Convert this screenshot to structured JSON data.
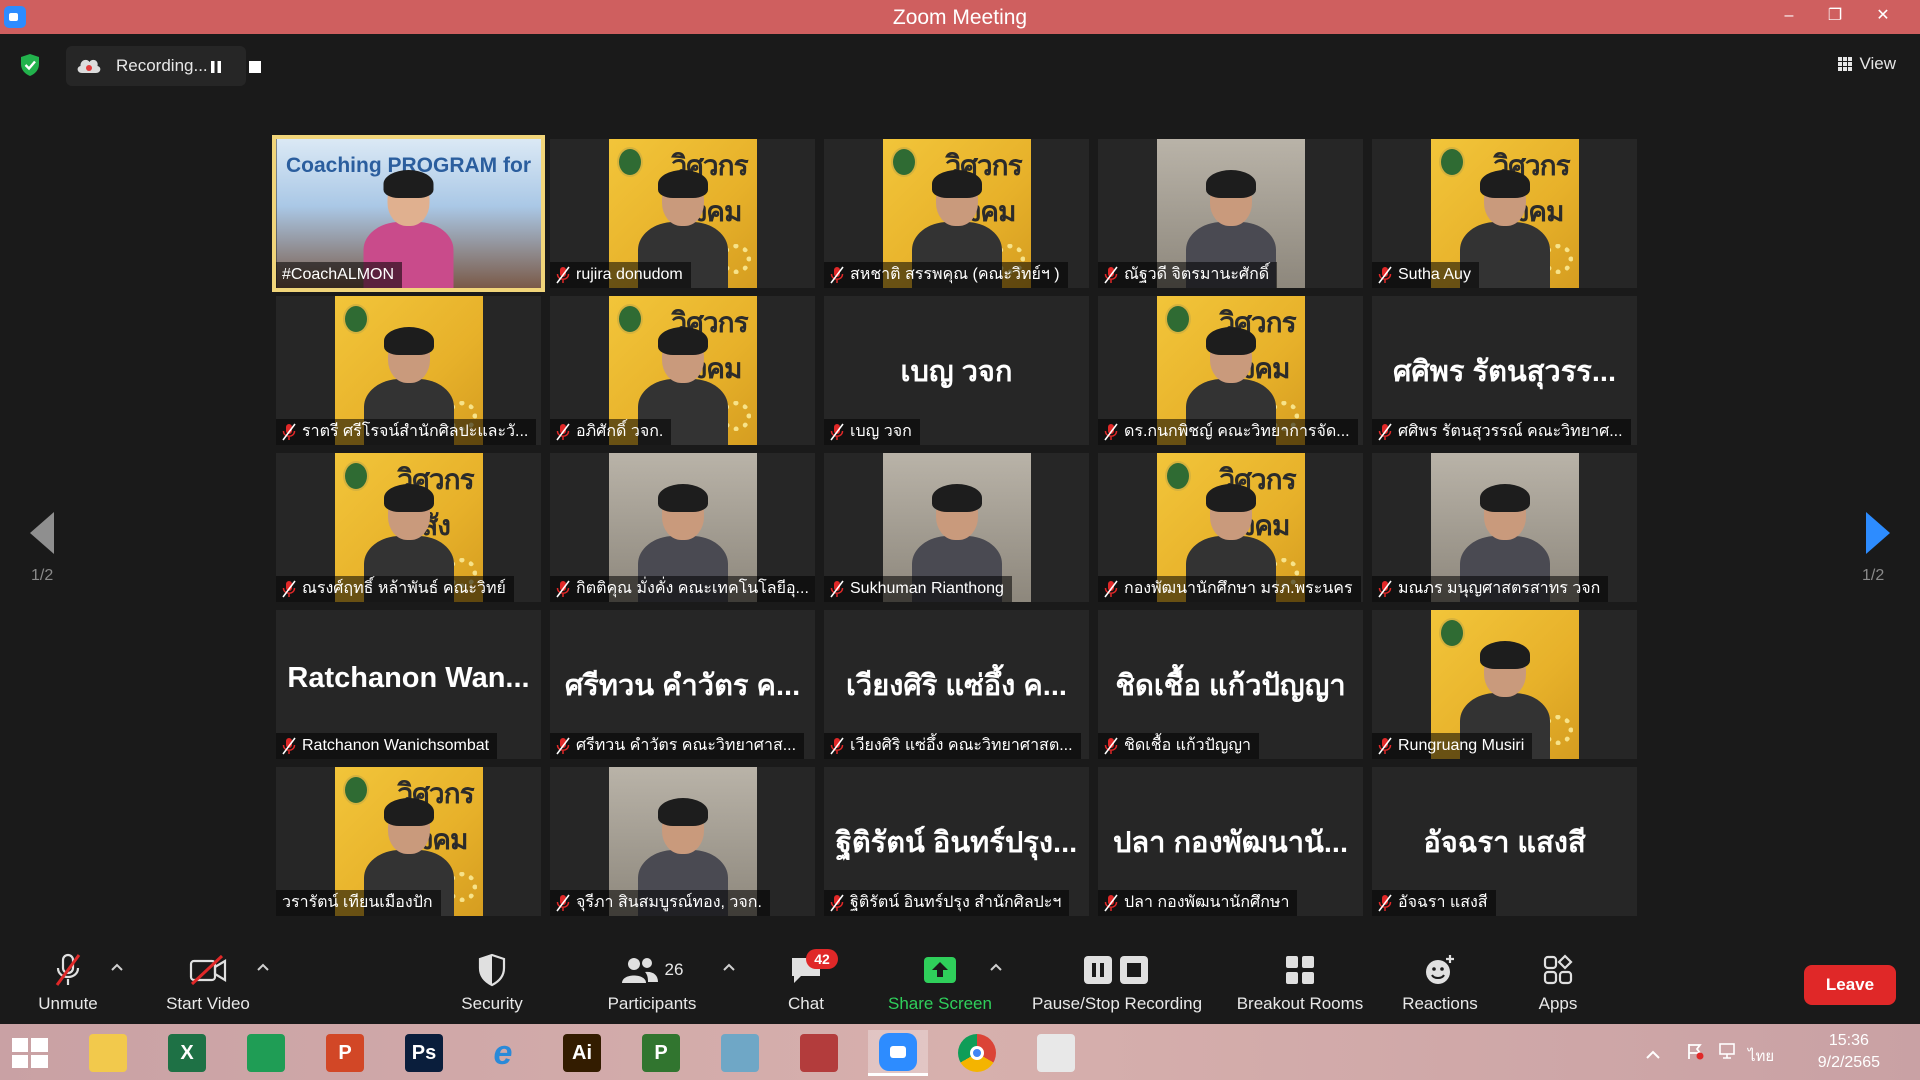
{
  "window": {
    "title": "Zoom Meeting",
    "minimize": "–",
    "restore": "❐",
    "close": "✕"
  },
  "top_bar": {
    "recording_label": "Recording...",
    "view_label": "View"
  },
  "pager": {
    "left": "1/2",
    "right": "1/2"
  },
  "participants": [
    {
      "name": "#CoachALMON",
      "video": "presenter",
      "active": true,
      "muted": false,
      "poster_text": "Coaching PROGRAM for"
    },
    {
      "name": "rujira donudom",
      "video": "poster",
      "muted": true,
      "poster_text": "วิศวกร สังคม"
    },
    {
      "name": "สหชาติ สรรพคุณ (คณะวิทย์ฯ )",
      "video": "poster",
      "muted": true,
      "poster_text": "วิศวกร สังคม"
    },
    {
      "name": "ณัฐวดี จิตรมานะศักดิ์",
      "video": "camera",
      "muted": true
    },
    {
      "name": "Sutha Auy",
      "video": "poster",
      "muted": true,
      "poster_text": "วิศวกร สังคม"
    },
    {
      "name": "ราตรี   ศรีโรจน์สำนักศิลปะและวั...",
      "video": "poster",
      "muted": true,
      "poster_text": ""
    },
    {
      "name": "อภิศักดิ์ วจก.",
      "video": "poster",
      "muted": true,
      "poster_text": "วิศวกร สังคม"
    },
    {
      "name": "เบญ วจก",
      "video": "none",
      "muted": true,
      "display_name": "เบญ วจก"
    },
    {
      "name": "ดร.กนกพิชญ์ คณะวิทยาการจัด...",
      "video": "poster",
      "muted": true,
      "poster_text": "วิศวกร สังคม"
    },
    {
      "name": "ศศิพร รัตนสุวรรณ์ คณะวิทยาศ...",
      "video": "none",
      "muted": true,
      "display_name": "ศศิพร รัตนสุวรร..."
    },
    {
      "name": "ณรงศ์ฤทธิ์ หล้าพันธ์ คณะวิทย์",
      "video": "poster",
      "muted": true,
      "poster_text": "วิศวกร สัง"
    },
    {
      "name": "กิตติคุณ มั่งคั่ง คณะเทคโนโลยีอุ...",
      "video": "camera",
      "muted": true
    },
    {
      "name": "Sukhuman Rianthong",
      "video": "camera",
      "muted": true
    },
    {
      "name": "กองพัฒนานักศึกษา มรภ.พระนคร",
      "video": "poster",
      "muted": true,
      "poster_text": "วิศวกร สังคม"
    },
    {
      "name": "มณภร มนุญศาสตรสาทร วจก",
      "video": "camera",
      "muted": true
    },
    {
      "name": "Ratchanon Wanichsombat",
      "video": "none",
      "muted": true,
      "display_name": "Ratchanon  Wan..."
    },
    {
      "name": "ศรีทวน  คำวัตร คณะวิทยาศาส...",
      "video": "none",
      "muted": true,
      "display_name": "ศรีทวน  คำวัตร ค..."
    },
    {
      "name": "เวียงศิริ  แซ่อึ้ง  คณะวิทยาศาสต...",
      "video": "none",
      "muted": true,
      "display_name": "เวียงศิริ  แซ่อึ้ง  ค..."
    },
    {
      "name": "ชิดเชื้อ แก้วปัญญา",
      "video": "none",
      "muted": true,
      "display_name": "ชิดเชื้อ แก้วปัญญา"
    },
    {
      "name": "Rungruang Musiri",
      "video": "poster",
      "muted": true,
      "poster_text": ""
    },
    {
      "name": "วรารัตน์ เทียนเมืองปัก",
      "video": "poster",
      "muted": false,
      "poster_text": "วิศวกร สังคม"
    },
    {
      "name": "จุรีภา สินสมบูรณ์ทอง, วจก.",
      "video": "camera",
      "muted": true
    },
    {
      "name": "ฐิติรัตน์ อินทร์ปรุง สำนักศิลปะฯ",
      "video": "none",
      "muted": true,
      "display_name": "ฐิติรัตน์ อินทร์ปรุง..."
    },
    {
      "name": "ปลา กองพัฒนานักศึกษา",
      "video": "none",
      "muted": true,
      "display_name": "ปลา กองพัฒนานั..."
    },
    {
      "name": "อัจฉรา แสงสี",
      "video": "none",
      "muted": true,
      "display_name": "อัจฉรา แสงสี"
    }
  ],
  "toolbar": {
    "unmute": "Unmute",
    "start_video": "Start Video",
    "security": "Security",
    "participants": "Participants",
    "participants_count": "26",
    "chat": "Chat",
    "chat_badge": "42",
    "share_screen": "Share Screen",
    "pause_stop_recording": "Pause/Stop Recording",
    "breakout_rooms": "Breakout Rooms",
    "reactions": "Reactions",
    "apps": "Apps",
    "leave": "Leave"
  },
  "taskbar": {
    "apps": [
      "file-explorer",
      "excel",
      "store",
      "powerpoint",
      "photoshop",
      "internet-explorer",
      "illustrator",
      "project",
      "notes",
      "photoscape",
      "zoom",
      "chrome",
      "photos"
    ],
    "app_labels": {
      "excel": "X",
      "powerpoint": "P",
      "photoshop": "Ps",
      "illustrator": "Ai",
      "project": "P"
    },
    "language": "ไทย",
    "time": "15:36",
    "date": "9/2/2565"
  },
  "colors": {
    "title_bar": "#cf5f5f",
    "meeting_bg": "#1a1a1a",
    "tile_bg": "#262626",
    "active_speaker": "#f1d57a",
    "muted_red": "#e02828",
    "share_green": "#2fcf5b",
    "leave_red": "#e02828",
    "poster_yellow": "#f2c53a"
  }
}
